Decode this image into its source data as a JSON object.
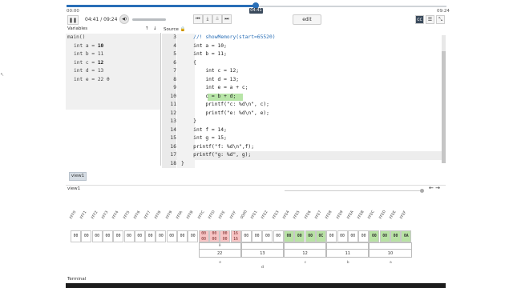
{
  "player": {
    "time_start": "00:00",
    "time_end": "09:24",
    "tooltip": "04:41",
    "time_display": "04:41 / 09:24",
    "progress_fraction": 0.498,
    "edit_label": "edit"
  },
  "variables": {
    "header": "Variables",
    "frame": "main()",
    "items": [
      {
        "text": "int a = ",
        "value": "10",
        "dim": false
      },
      {
        "text": "int b = ",
        "value": "11",
        "dim": true
      },
      {
        "text": "int c = ",
        "value": "12",
        "dim": false
      },
      {
        "text": "int d = ",
        "value": "13",
        "dim": true
      },
      {
        "text": "int e = ",
        "value": "22 θ",
        "dim": true
      }
    ]
  },
  "source": {
    "header": "Source",
    "lines": [
      {
        "n": "3",
        "text": "    //! showMemory(start=65520)",
        "comment": true
      },
      {
        "n": "4",
        "text": "    int a = 10;"
      },
      {
        "n": "5",
        "text": "    int b = 11;"
      },
      {
        "n": "6",
        "text": "    {"
      },
      {
        "n": "7",
        "text": "        int c = 12;"
      },
      {
        "n": "8",
        "text": "        int d = 13;"
      },
      {
        "n": "9",
        "text": "        int e = a + c;"
      },
      {
        "n": "10",
        "text": "        c = b + d;",
        "hl": true
      },
      {
        "n": "11",
        "text": "        printf(\"c: %d\\n\", c);"
      },
      {
        "n": "12",
        "text": "        printf(\"e: %d\\n\", e);"
      },
      {
        "n": "13",
        "text": "    }"
      },
      {
        "n": "14",
        "text": "    int f = 14;"
      },
      {
        "n": "15",
        "text": "    int g = 15;"
      },
      {
        "n": "16",
        "text": "    printf(\"f: %d\\n\",f);"
      },
      {
        "n": "17",
        "text": "    printf(\"g: %d\", g);",
        "cur": true
      },
      {
        "n": "18",
        "text": "}"
      }
    ]
  },
  "view": {
    "tab": "view1",
    "title": "view1"
  },
  "memory": {
    "addresses": [
      "FFF0",
      "FFF1",
      "FFF2",
      "FFF3",
      "FFF4",
      "FFF5",
      "FFF6",
      "FFF7",
      "FFF8",
      "FFF9",
      "FFFA",
      "FFFB",
      "FFFC",
      "FFFD",
      "FFFE",
      "FFFF",
      "0000",
      "FFE1",
      "FFE2",
      "FFE3",
      "FFE4",
      "FFE5",
      "FFE6",
      "FFE7",
      "FFE8",
      "FFE9",
      "FFEA",
      "FFEB",
      "FFEC",
      "FFED",
      "FFEE",
      "FFEF"
    ],
    "cells": [
      {
        "v": "00",
        "s": ""
      },
      {
        "v": "00",
        "s": ""
      },
      {
        "v": "00",
        "s": ""
      },
      {
        "v": "00",
        "s": ""
      },
      {
        "v": "00",
        "s": ""
      },
      {
        "v": "00",
        "s": ""
      },
      {
        "v": "00",
        "s": ""
      },
      {
        "v": "00",
        "s": ""
      },
      {
        "v": "00",
        "s": ""
      },
      {
        "v": "00",
        "s": ""
      },
      {
        "v": "00",
        "s": ""
      },
      {
        "v": "00",
        "s": ""
      },
      {
        "v": "00\n00",
        "s": "pink"
      },
      {
        "v": "00\n00",
        "s": "pink"
      },
      {
        "v": "00\n00",
        "s": "pink"
      },
      {
        "v": "16\n16",
        "s": "pink"
      },
      {
        "v": "00",
        "s": ""
      },
      {
        "v": "00",
        "s": ""
      },
      {
        "v": "00",
        "s": ""
      },
      {
        "v": "00",
        "s": ""
      },
      {
        "v": "00",
        "s": "green"
      },
      {
        "v": "00",
        "s": "green"
      },
      {
        "v": "00",
        "s": "green"
      },
      {
        "v": "0C",
        "s": "green"
      },
      {
        "v": "00",
        "s": ""
      },
      {
        "v": "00",
        "s": ""
      },
      {
        "v": "00",
        "s": ""
      },
      {
        "v": "00",
        "s": ""
      },
      {
        "v": "00",
        "s": "green"
      },
      {
        "v": "00",
        "s": "green"
      },
      {
        "v": "00",
        "s": "green"
      },
      {
        "v": "0A",
        "s": "green"
      }
    ],
    "groups": [
      {
        "label": "22",
        "sub": "θ",
        "var": "e"
      },
      {
        "label": "13",
        "sub": "",
        "var": ""
      },
      {
        "label": "12",
        "sub": "",
        "var": "c"
      },
      {
        "label": "11",
        "sub": "",
        "var": "b"
      },
      {
        "label": "10",
        "sub": "",
        "var": "a"
      }
    ],
    "bottom_label": "d"
  },
  "terminal": {
    "header": "Terminal"
  },
  "colors": {
    "accent": "#2a6fb7",
    "highlight": "#b8e5a8",
    "pink": "#f7c4c4",
    "green": "#b8e2a4"
  }
}
